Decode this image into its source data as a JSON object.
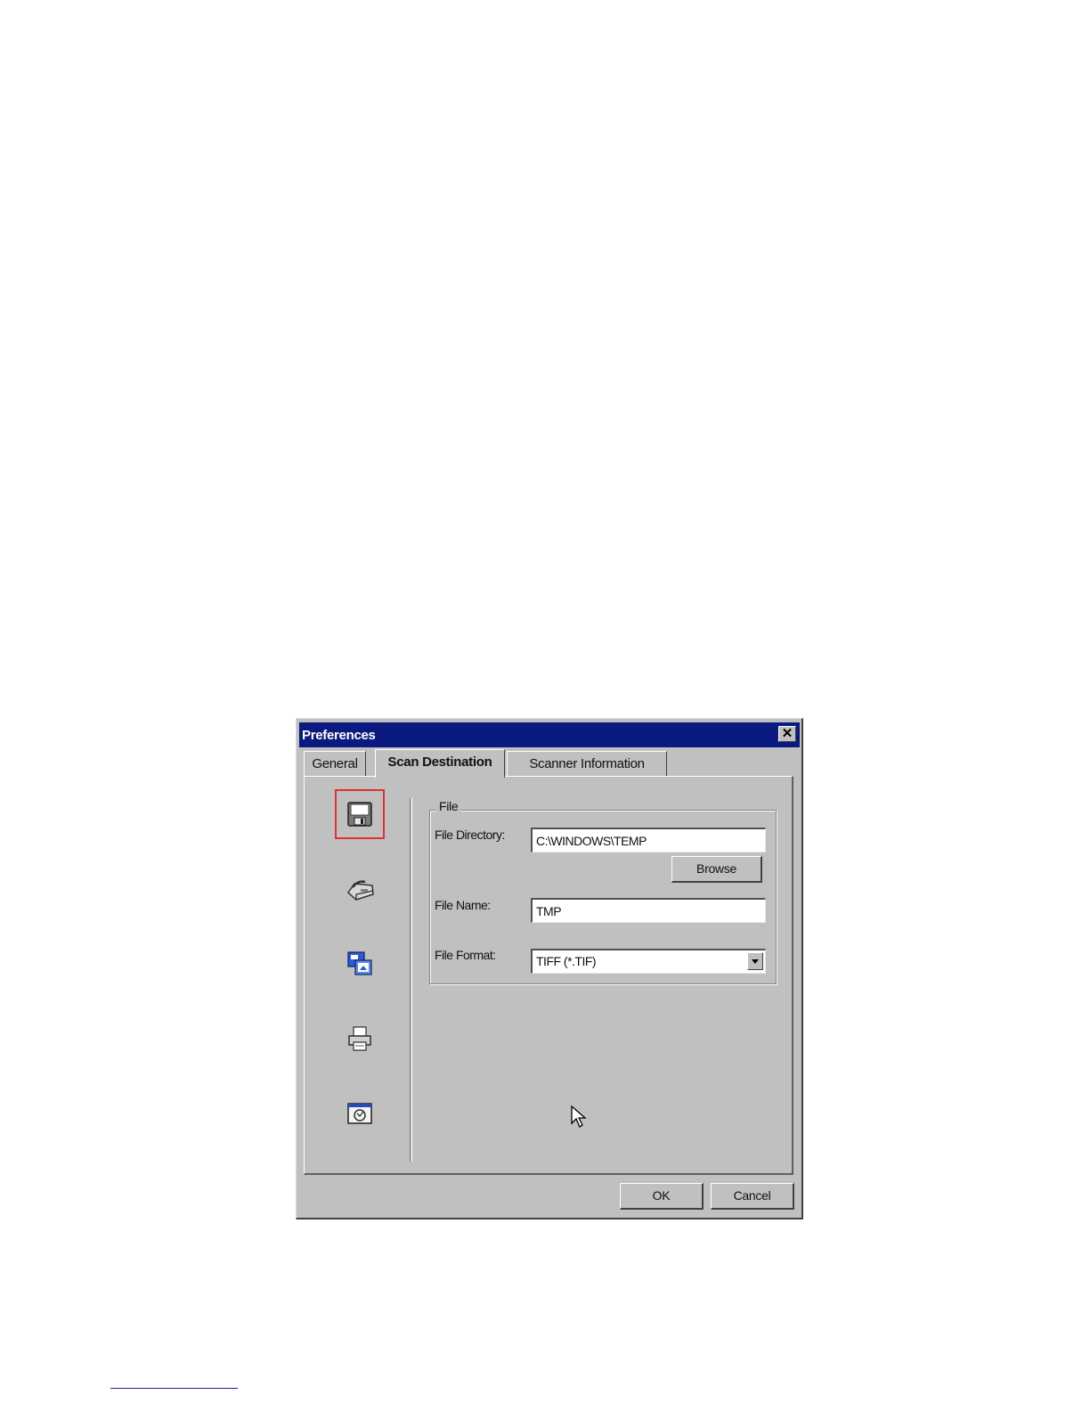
{
  "dialog": {
    "title": "Preferences",
    "close_glyph": "✕"
  },
  "tabs": [
    {
      "label": "General",
      "active": false
    },
    {
      "label": "Scan Destination",
      "active": true
    },
    {
      "label": "Scanner Information",
      "active": false
    }
  ],
  "destinations": [
    {
      "icon": "floppy-disk-icon",
      "selected": true
    },
    {
      "icon": "fax-icon",
      "selected": false
    },
    {
      "icon": "image-application-icon",
      "selected": false
    },
    {
      "icon": "printer-icon",
      "selected": false
    },
    {
      "icon": "email-icon",
      "selected": false
    }
  ],
  "file_group": {
    "label": "File",
    "directory_label": "File Directory:",
    "directory_value": "C:\\WINDOWS\\TEMP",
    "browse_label": "Browse",
    "name_label": "File Name:",
    "name_value": "TMP",
    "format_label": "File Format:",
    "format_value": "TIFF (*.TIF)"
  },
  "footer": {
    "ok_label": "OK",
    "cancel_label": "Cancel"
  },
  "colors": {
    "titlebar": "#0a1a80",
    "face": "#c0c0c0",
    "selection_outline": "#e03030"
  }
}
